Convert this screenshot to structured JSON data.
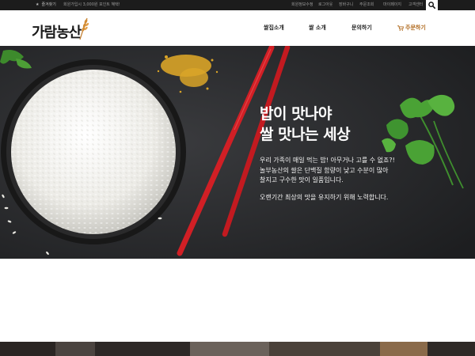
{
  "topbar": {
    "favorite": "즐겨찾기",
    "promo": "회원가입시 3,000원 포인트 혜택!",
    "links": [
      "회원정보수정",
      "로그아웃",
      "장바구니",
      "주문조회",
      "마이페이지",
      "고객센터"
    ]
  },
  "header": {
    "logo": "가람농산",
    "nav": [
      "쌀집소개",
      "쌀 소개",
      "문의하기",
      "주문하기"
    ]
  },
  "hero": {
    "title_line1": "밥이 맛나야",
    "title_line2": "쌀 맛나는 세상",
    "body": [
      "우리 가족이 매일 먹는 밥! 아무거나 고를 수 없죠?!",
      "놀부농산의 쌀은 단백질 함량이 낮고 수분이 많아",
      "찰지고 구수한 맛이 일품입니다.",
      "오랜기간 최상의 맛을 유지하기 위해 노력합니다."
    ]
  },
  "colors": {
    "topbar": "#1c1c1c",
    "accent": "#b06a1e",
    "hero_bg": "#242527",
    "chopsticks": "#d11f25"
  },
  "icons": [
    "star-icon",
    "search-icon",
    "wheat-icon",
    "cart-icon"
  ]
}
